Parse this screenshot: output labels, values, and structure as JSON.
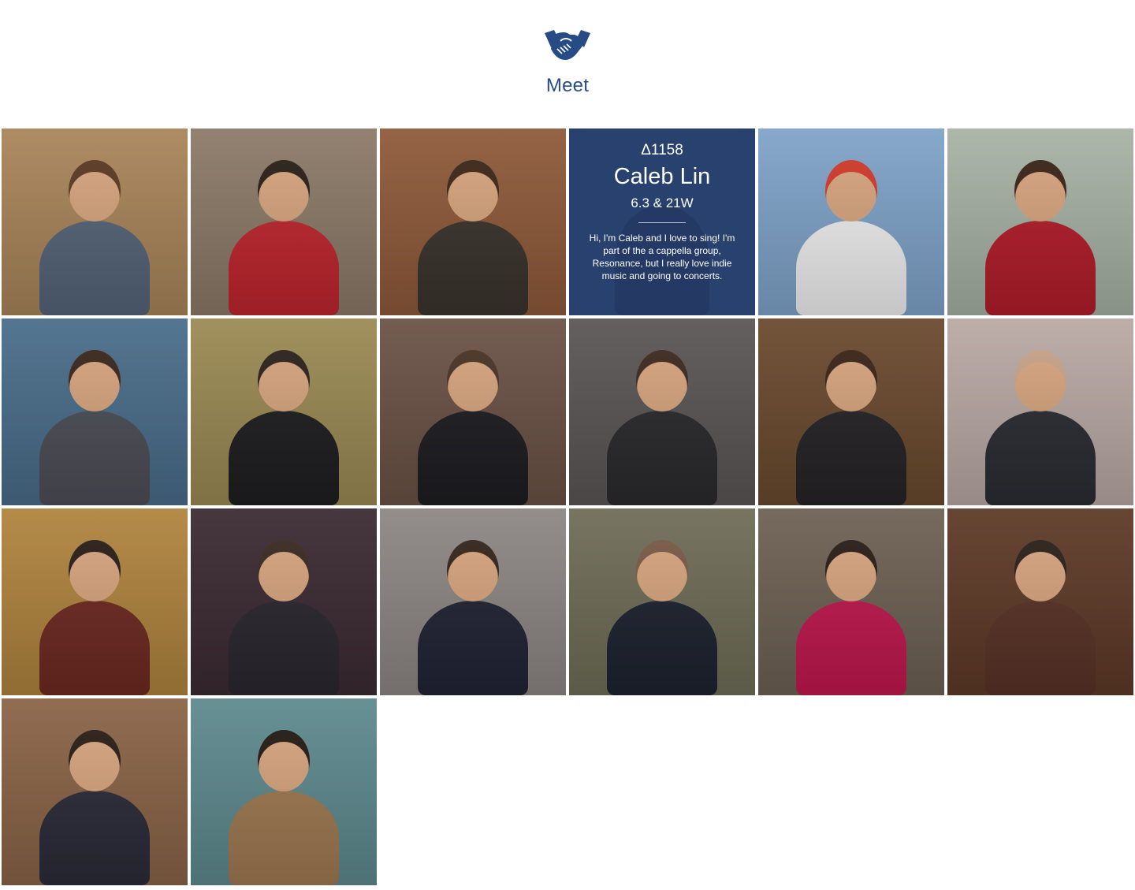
{
  "header": {
    "icon": "handshake-icon",
    "title": "Meet",
    "accent_color": "#274b85"
  },
  "tiles": [
    {
      "bg": "#a9855a",
      "fig": "#55657a",
      "head": "#5a3a22"
    },
    {
      "bg": "#8c7a68",
      "fig": "#c0262e",
      "head": "#2a1f18"
    },
    {
      "bg": "#8f5a3a",
      "fig": "#3b342e",
      "head": "#3d2718"
    },
    {
      "bg": "#5e6a78",
      "fig": "#3f3a36",
      "head": "#6b4a33"
    },
    {
      "bg": "#7fa3c9",
      "fig": "#f1f1f1",
      "head": "#d23a2a"
    },
    {
      "bg": "#a7b2a4",
      "fig": "#b31d2a",
      "head": "#3a2417"
    },
    {
      "bg": "#4a6d8a",
      "fig": "#4d4f57",
      "head": "#3a271c"
    },
    {
      "bg": "#9b8a54",
      "fig": "#1f1e20",
      "head": "#2c221c"
    },
    {
      "bg": "#6b5246",
      "fig": "#1e1e22",
      "head": "#4a3426"
    },
    {
      "bg": "#5b5656",
      "fig": "#2b2b2e",
      "head": "#3e2a1f"
    },
    {
      "bg": "#6a4a2e",
      "fig": "#262426",
      "head": "#3a2418"
    },
    {
      "bg": "#b9a9a4",
      "fig": "#2b2d33",
      "head": "#c9a58a"
    },
    {
      "bg": "#b0843e",
      "fig": "#6e2a22",
      "head": "#2a1d17"
    },
    {
      "bg": "#3b2b32",
      "fig": "#2b2730",
      "head": "#3a2a21"
    },
    {
      "bg": "#8d8784",
      "fig": "#222436",
      "head": "#35251c"
    },
    {
      "bg": "#6f6d57",
      "fig": "#1d2330",
      "head": "#7a5a46"
    },
    {
      "bg": "#6e6154",
      "fig": "#c2184e",
      "head": "#2a1d18"
    },
    {
      "bg": "#5e3a27",
      "fig": "#5a3327",
      "head": "#2c211b"
    },
    {
      "bg": "#8a6447",
      "fig": "#2c2c3a",
      "head": "#2a1d16"
    },
    {
      "bg": "#5e8a8f",
      "fig": "#a07a52",
      "head": "#231a15"
    }
  ],
  "featured": {
    "id": "Δ1158",
    "name": "Caleb Lin",
    "subtitle": "6.3 & 21W",
    "bio": "Hi, I'm Caleb and I love to sing! I'm part of the a cappella group, Resonance, but I really love indie music and going to concerts.",
    "overlay_color": "#1f3a6c"
  }
}
